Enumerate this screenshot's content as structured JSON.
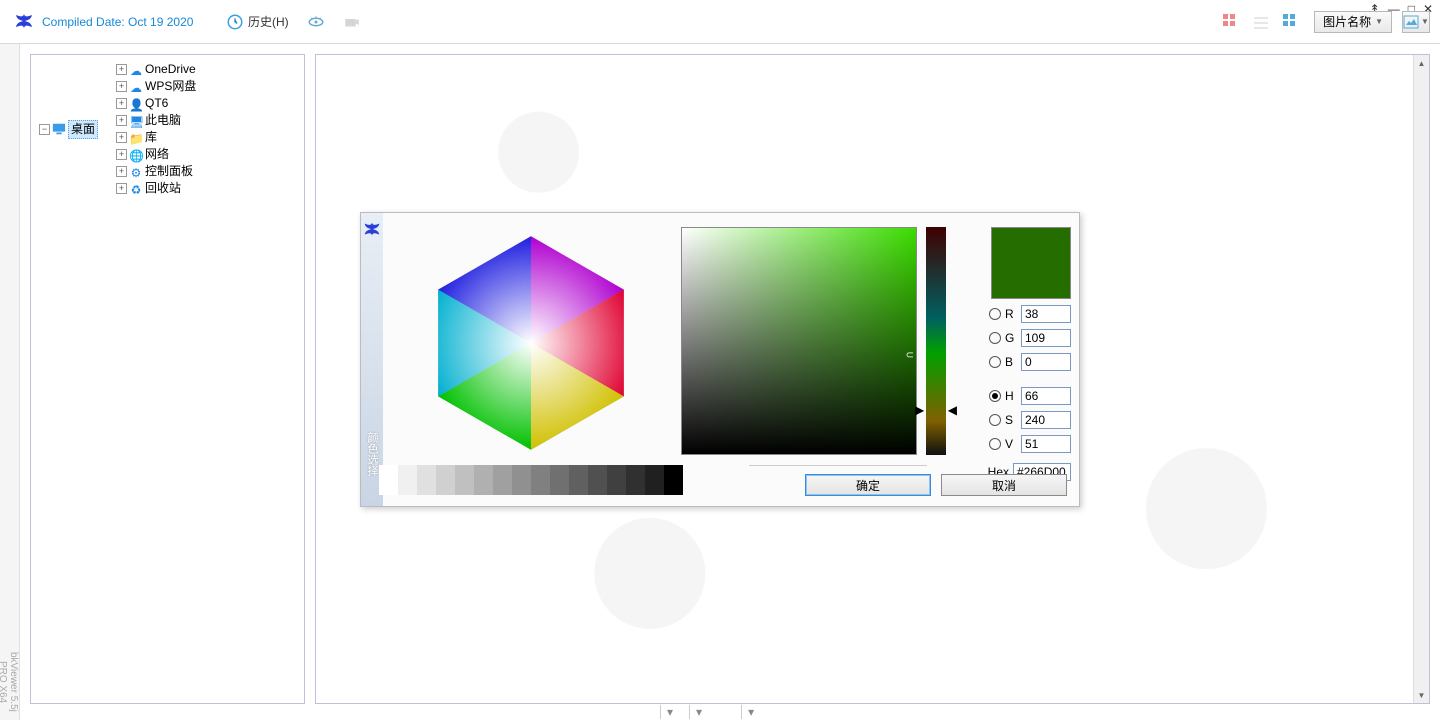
{
  "brand": {
    "compiled_label": "Compiled Date: Oct 19 2020"
  },
  "toolbar": {
    "history_label": "历史(H)",
    "sort_label": "图片名称"
  },
  "tree": {
    "root": "桌面",
    "children": [
      "OneDrive",
      "WPS网盘",
      "QT6",
      "此电脑",
      "库",
      "网络",
      "控制面板",
      "回收站"
    ]
  },
  "picker": {
    "side_label": "颜色选择",
    "r_label": "R",
    "g_label": "G",
    "b_label": "B",
    "h_label": "H",
    "s_label": "S",
    "v_label": "V",
    "r": "38",
    "g": "109",
    "b": "0",
    "h": "66",
    "s": "240",
    "v": "51",
    "hex_label": "Hex",
    "hex": "#266D00",
    "selected_color": "#266D00",
    "grays": [
      "#ffffff",
      "#f0f0f0",
      "#e0e0e0",
      "#d0d0d0",
      "#c0c0c0",
      "#b0b0b0",
      "#a0a0a0",
      "#909090",
      "#808080",
      "#707070",
      "#606060",
      "#505050",
      "#404040",
      "#303030",
      "#202020",
      "#000000"
    ],
    "ok_label": "确定",
    "cancel_label": "取消"
  },
  "status": {
    "a": "",
    "b": "",
    "c": "",
    "d": ""
  },
  "left_gutter_text": "bkViewer 5.5j PRO X64"
}
